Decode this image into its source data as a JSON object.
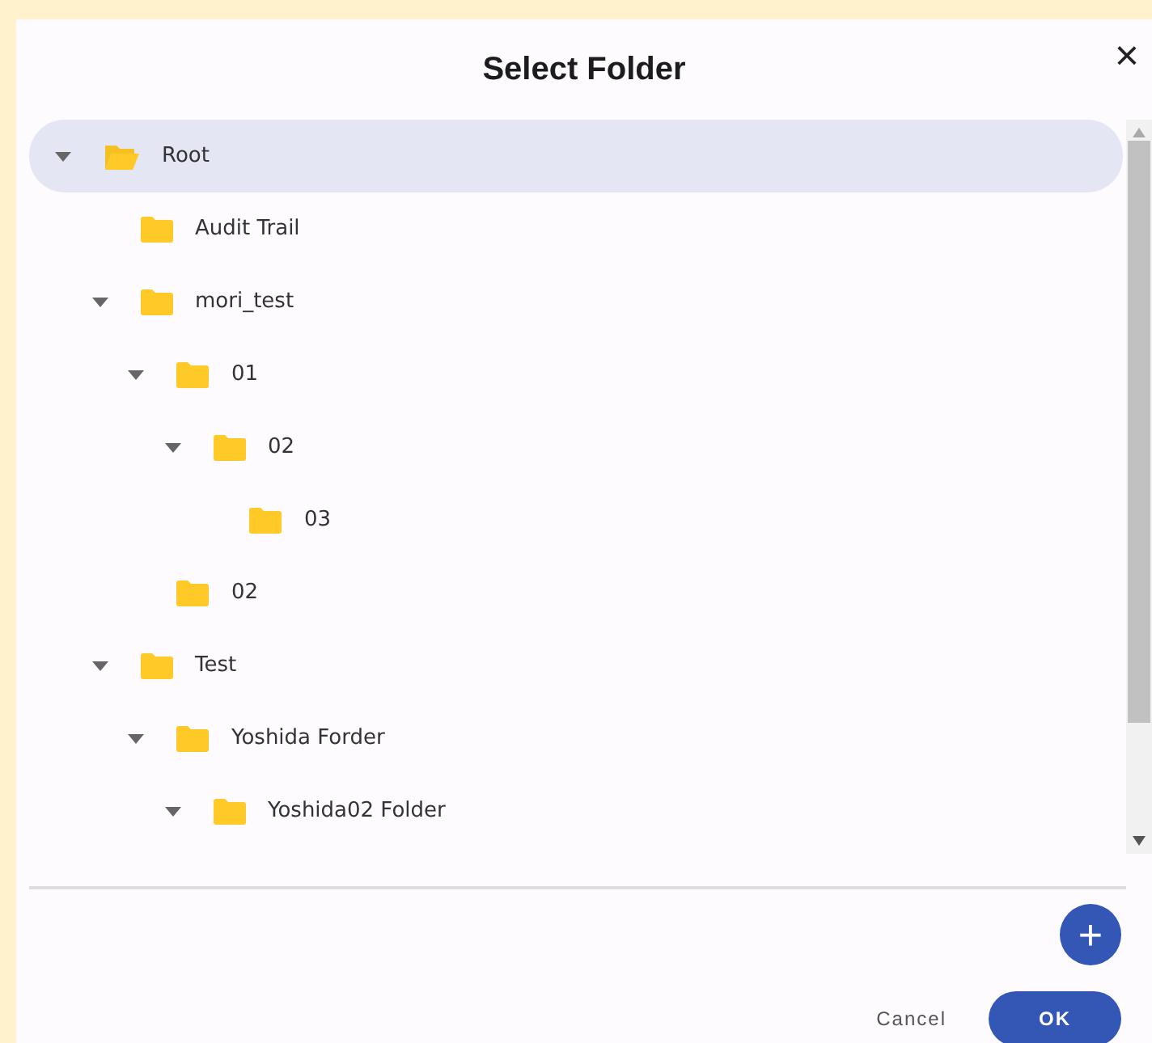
{
  "dialog": {
    "title": "Select Folder",
    "close": "×"
  },
  "tree": [
    {
      "label": "Root",
      "selected": true,
      "expanded": true,
      "children": [
        {
          "label": "Audit Trail",
          "selected": false
        },
        {
          "label": "mori_test",
          "selected": false,
          "expanded": true,
          "children": [
            {
              "label": "01",
              "selected": false,
              "expanded": true,
              "children": [
                {
                  "label": "02",
                  "selected": false,
                  "expanded": true,
                  "children": [
                    {
                      "label": "03",
                      "selected": false
                    }
                  ]
                }
              ]
            },
            {
              "label": "02",
              "selected": false
            }
          ]
        },
        {
          "label": "Test",
          "selected": false,
          "expanded": true,
          "children": [
            {
              "label": "Yoshida Forder",
              "selected": false,
              "expanded": true,
              "children": [
                {
                  "label": "Yoshida02 Folder",
                  "selected": false,
                  "expanded": true
                }
              ]
            }
          ]
        }
      ]
    }
  ],
  "add_button": "+",
  "buttons": [
    {
      "label": "Cancel",
      "kind": "text"
    },
    {
      "label": "OK",
      "kind": "primary"
    }
  ]
}
